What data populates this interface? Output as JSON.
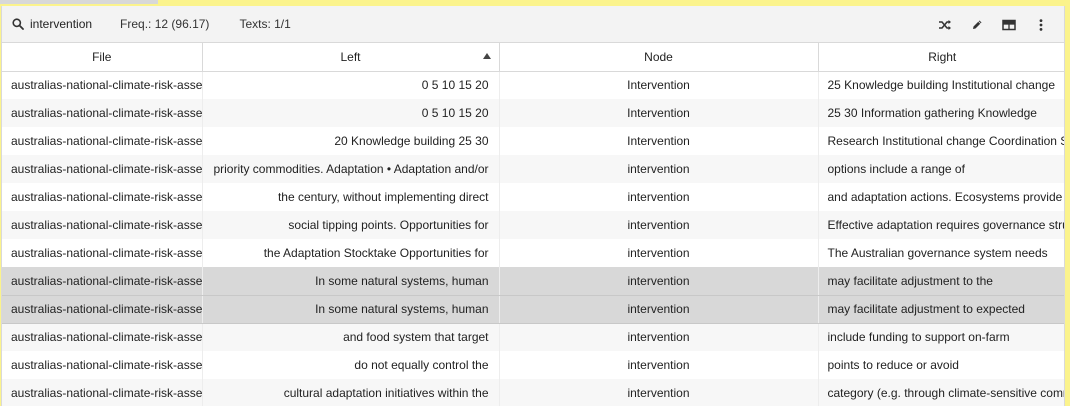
{
  "toolbar": {
    "search_term": "intervention",
    "freq": "Freq.: 12 (96.17)",
    "texts": "Texts: 1/1",
    "icons": [
      "search-icon",
      "shuffle-icon",
      "edit-icon",
      "table-icon",
      "more-vertical-icon"
    ]
  },
  "columns": {
    "file": "File",
    "left": "Left",
    "node": "Node",
    "right": "Right"
  },
  "rows": [
    {
      "file": "australias-national-climate-risk-assessment",
      "left": "0  5  10  15  20",
      "node": "Intervention",
      "right": "25  Knowledge building  Institutional  change"
    },
    {
      "file": "australias-national-climate-risk-assessment",
      "left": "0  5  10  15  20",
      "node": "Intervention",
      "right": "25  30  Information  gathering  Knowledge"
    },
    {
      "file": "australias-national-climate-risk-assessment",
      "left": "20  Knowledge building  25  30",
      "node": "Intervention",
      "right": "Research Institutional  change  Coordination Stakeholder"
    },
    {
      "file": "australias-national-climate-risk-assessment",
      "left": "priority commodities.  Adaptation • Adaptation and/or",
      "node": "intervention",
      "right": "options    include a range of"
    },
    {
      "file": "australias-national-climate-risk-assessment",
      "left": "the  century, without implementing direct",
      "node": "intervention",
      "right": "and adaptation actions. Ecosystems provide"
    },
    {
      "file": "australias-national-climate-risk-assessment",
      "left": "social tipping points.  Opportunities for",
      "node": "intervention",
      "right": "Effective adaptation requires governance structures"
    },
    {
      "file": "australias-national-climate-risk-assessment",
      "left": "the Adaptation Stocktake  Opportunities for",
      "node": "intervention",
      "right": "The Australian governance system needs"
    },
    {
      "file": "australias-national-climate-risk-assessment",
      "left": "In  some natural systems, human",
      "node": "intervention",
      "right": "may facilitate adjustment to the"
    },
    {
      "file": "australias-national-climate-risk-assessment",
      "left": "In some natural  systems, human",
      "node": "intervention",
      "right": "may facilitate adjustment  to expected"
    },
    {
      "file": "australias-national-climate-risk-assessment",
      "left": "and food system  that target",
      "node": "intervention",
      "right": "include funding to support on-farm"
    },
    {
      "file": "australias-national-climate-risk-assessment",
      "left": "do not equally control the",
      "node": "intervention",
      "right": "points to  reduce or avoid"
    },
    {
      "file": "australias-national-climate-risk-assessment",
      "left": "cultural adaptation  initiatives within the",
      "node": "intervention",
      "right": "category (e.g. through climate-sensitive community"
    }
  ],
  "selected_rows": [
    7,
    8
  ],
  "colors": {
    "background": "#fbf38c",
    "toolbar": "#f3f3f3",
    "selected_row": "#d8d8d8"
  }
}
